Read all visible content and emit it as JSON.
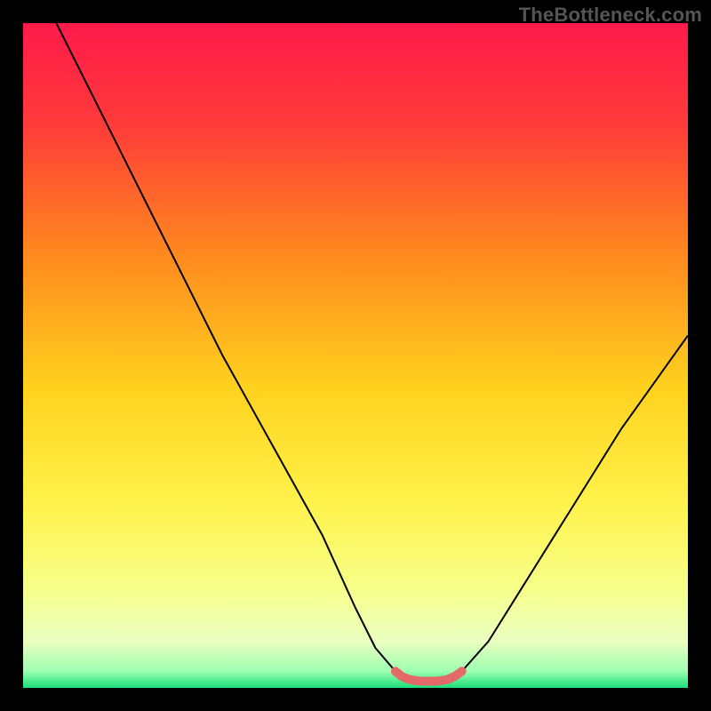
{
  "watermark": "TheBottleneck.com",
  "chart_data": {
    "type": "line",
    "title": "",
    "xlabel": "",
    "ylabel": "",
    "xlim": [
      0,
      100
    ],
    "ylim": [
      0,
      100
    ],
    "series": [
      {
        "name": "bottleneck-curve",
        "x": [
          5,
          10,
          15,
          20,
          25,
          30,
          35,
          40,
          45,
          50,
          53,
          56,
          58,
          60,
          62,
          64,
          66,
          70,
          75,
          80,
          85,
          90,
          95,
          100
        ],
        "y": [
          100,
          90,
          80,
          70,
          60,
          50,
          41,
          32,
          23,
          12,
          6,
          2.5,
          1.3,
          1,
          1,
          1.3,
          2.5,
          7,
          15,
          23,
          31,
          39,
          46,
          53
        ]
      },
      {
        "name": "optimal-range-marker",
        "x": [
          56,
          57,
          58,
          59,
          60,
          61,
          62,
          63,
          64,
          65,
          66
        ],
        "y": [
          2.5,
          1.7,
          1.3,
          1.1,
          1.0,
          1.0,
          1.0,
          1.1,
          1.3,
          1.8,
          2.5
        ]
      }
    ],
    "background": {
      "gradient_stops": [
        {
          "pos": 0.0,
          "color": "#ff1a4b"
        },
        {
          "pos": 0.15,
          "color": "#ff3a3a"
        },
        {
          "pos": 0.35,
          "color": "#ff8a1e"
        },
        {
          "pos": 0.55,
          "color": "#ffd21e"
        },
        {
          "pos": 0.72,
          "color": "#fff24a"
        },
        {
          "pos": 0.85,
          "color": "#f7ff8a"
        },
        {
          "pos": 0.93,
          "color": "#eaffc0"
        },
        {
          "pos": 0.975,
          "color": "#9dffb0"
        },
        {
          "pos": 1.0,
          "color": "#18e07a"
        }
      ]
    },
    "line_styles": {
      "bottleneck-curve": {
        "stroke": "#000000",
        "width": 2
      },
      "optimal-range-marker": {
        "stroke": "#e46a6a",
        "width": 10,
        "linecap": "round"
      }
    }
  }
}
